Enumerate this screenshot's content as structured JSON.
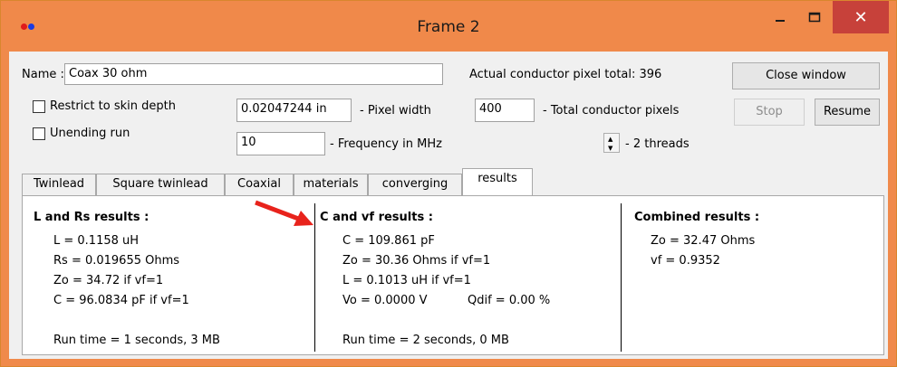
{
  "window": {
    "title": "Frame 2",
    "minimize_label": "_",
    "maximize_label": "☐",
    "close_label": "✕"
  },
  "form": {
    "name_label": "Name :",
    "name_value": "Coax 30 ohm",
    "pixel_total_label": "Actual conductor pixel total: 396",
    "close_window_label": "Close window",
    "restrict_label": "Restrict to skin depth",
    "pixel_width_value": "0.02047244 in",
    "pixel_width_label": "- Pixel width",
    "total_pixels_value": "400",
    "total_pixels_label": "- Total conductor pixels",
    "stop_label": "Stop",
    "resume_label": "Resume",
    "unending_label": "Unending run",
    "frequency_value": "10",
    "frequency_label": "- Frequency in MHz",
    "threads_label": "- 2 threads"
  },
  "tabs": [
    "Twinlead",
    "Square twinlead",
    "Coaxial",
    "materials",
    "converging",
    "results"
  ],
  "active_tab": "results",
  "results": {
    "l_rs": {
      "title": "L and Rs results :",
      "lines": [
        "L = 0.1158 uH",
        "Rs = 0.019655 Ohms",
        "Zo = 34.72 if vf=1",
        "C = 96.0834 pF if vf=1"
      ],
      "runtime": "Run time = 1 seconds, 3 MB"
    },
    "c_vf": {
      "title": "C and vf results :",
      "lines": [
        "C = 109.861 pF",
        "Zo = 30.36 Ohms if vf=1",
        "L = 0.1013 uH if vf=1",
        "Vo = 0.0000 V",
        "Qdif = 0.00 %"
      ],
      "runtime": "Run time = 2 seconds, 0 MB"
    },
    "combined": {
      "title": "Combined results :",
      "lines": [
        "Zo = 32.47 Ohms",
        "vf = 0.9352"
      ]
    }
  },
  "colors": {
    "titlebar": "#f0894a",
    "close_button": "#c7413a",
    "arrow": "#e8231c",
    "dot_red": "#e01b1b",
    "dot_blue": "#1b3be0"
  }
}
